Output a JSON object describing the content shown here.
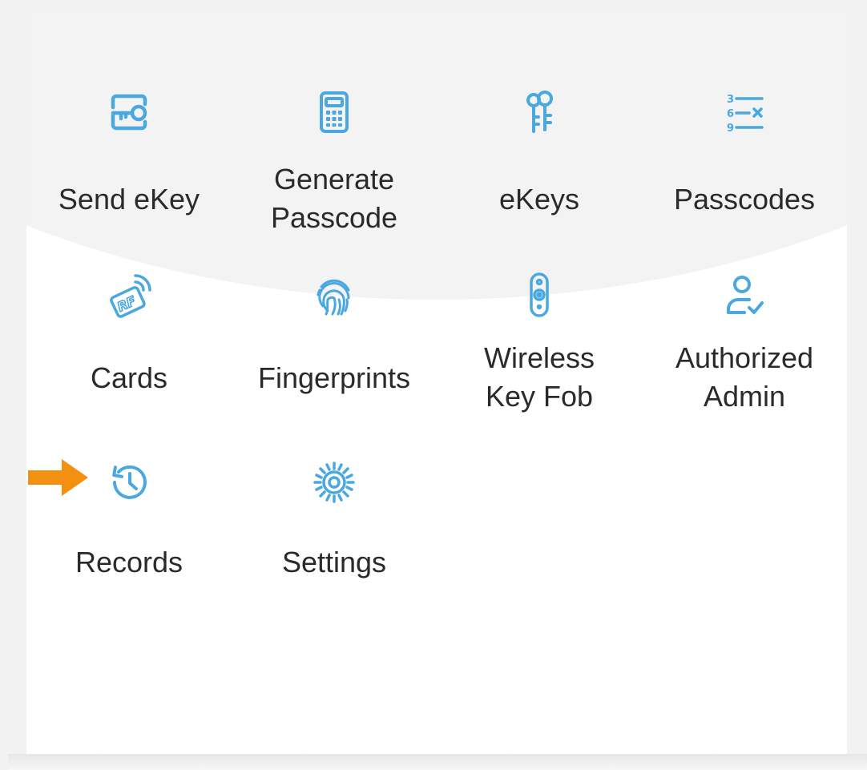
{
  "colors": {
    "icon": "#4aa8e0",
    "arrow": "#f39012",
    "label": "#2a2a2a"
  },
  "menu": {
    "items": [
      {
        "label": "Send eKey",
        "icon": "send-ekey-icon"
      },
      {
        "label": "Generate\nPasscode",
        "icon": "calculator-icon"
      },
      {
        "label": "eKeys",
        "icon": "keys-icon"
      },
      {
        "label": "Passcodes",
        "icon": "passcode-list-icon"
      },
      {
        "label": "Cards",
        "icon": "rf-card-icon"
      },
      {
        "label": "Fingerprints",
        "icon": "fingerprint-icon"
      },
      {
        "label": "Wireless\nKey Fob",
        "icon": "key-fob-icon"
      },
      {
        "label": "Authorized\nAdmin",
        "icon": "admin-check-icon"
      },
      {
        "label": "Records",
        "icon": "history-icon"
      },
      {
        "label": "Settings",
        "icon": "gear-icon"
      }
    ]
  },
  "pointer": {
    "icon": "arrow-right-icon"
  }
}
